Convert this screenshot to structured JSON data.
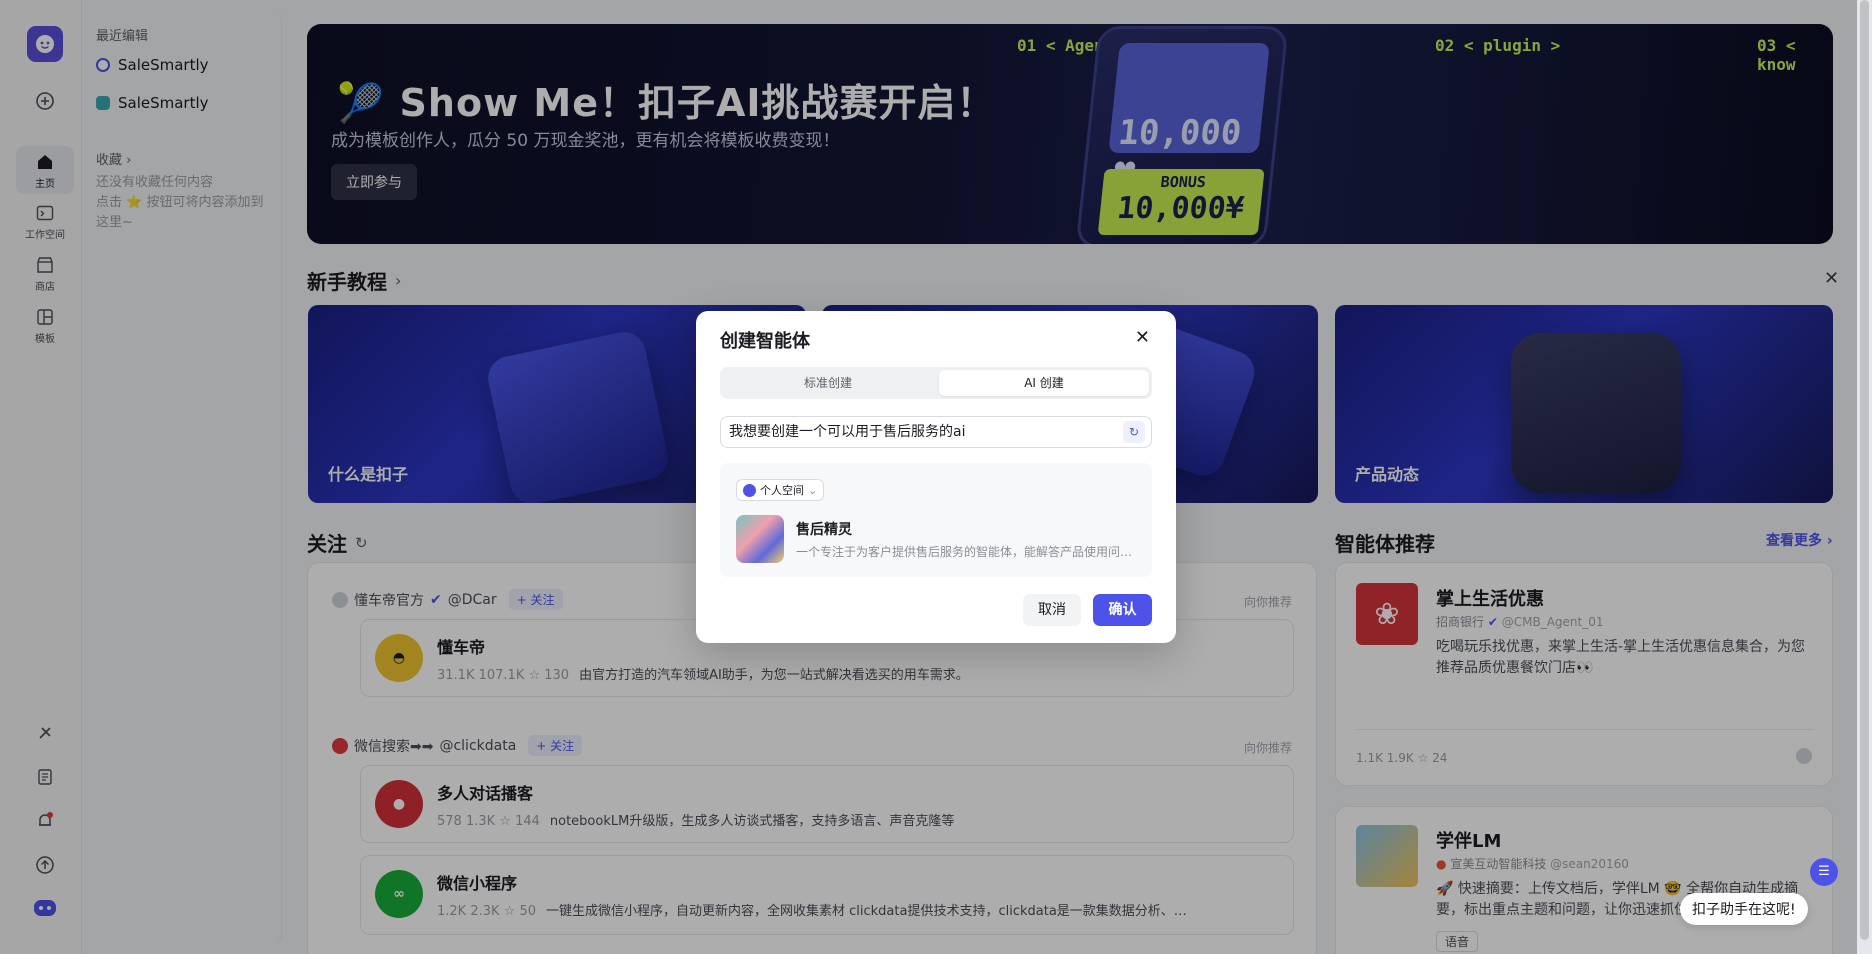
{
  "rail": {
    "items": [
      {
        "label": "主页",
        "icon": "home-icon"
      },
      {
        "label": "工作空间",
        "icon": "terminal-icon"
      },
      {
        "label": "商店",
        "icon": "store-icon"
      },
      {
        "label": "模板",
        "icon": "template-icon"
      }
    ]
  },
  "side": {
    "recent_title": "最近编辑",
    "recent": [
      {
        "label": "SaleSmartly"
      },
      {
        "label": "SaleSmartly"
      }
    ],
    "fav_title": "收藏",
    "fav_empty": "还没有收藏任何内容\n点击 ⭐ 按钮可将内容添加到这里~"
  },
  "banner": {
    "title": "🎾 Show Me！扣子AI挑战赛开启！",
    "subtitle": "成为模板创作人，瓜分 50 万现金奖池，更有机会将模板收费变现！",
    "join": "立即参与",
    "tags": [
      "01 < Agent>",
      "02 < plugin >",
      "03 < know"
    ],
    "score": "10,000 ♥",
    "bonus_label": "BONUS",
    "bonus_value": "10,000¥"
  },
  "tutorials": {
    "title": "新手教程",
    "cards": [
      "什么是扣子",
      "",
      "产品动态"
    ]
  },
  "follow": {
    "title": "关注",
    "groups": [
      {
        "author": "懂车帝官方",
        "handle": "@DCar",
        "follow_label": "+ 关注",
        "rec": "向你推荐",
        "items": [
          {
            "name": "懂车帝",
            "meta": "31.1K   107.1K   ☆ 130",
            "desc": "由官方打造的汽车领域AI助手，为您一站式解决看选买的用车需求。"
          }
        ]
      },
      {
        "author": "微信搜索➡➡",
        "handle": "@clickdata",
        "follow_label": "+ 关注",
        "rec": "向你推荐",
        "items": [
          {
            "name": "多人对话播客",
            "meta": "578   1.3K   ☆ 144",
            "desc": "notebookLM升级版，生成多人访谈式播客，支持多语言、声音克隆等"
          },
          {
            "name": "微信小程序",
            "meta": "1.2K   2.3K   ☆ 50",
            "desc": "一键生成微信小程序，自动更新内容，全网收集素材 clickdata提供技术支持，clickdata是一款集数据分析、…"
          }
        ]
      }
    ]
  },
  "agents": {
    "title": "智能体推荐",
    "more": "查看更多 ›",
    "cards": [
      {
        "name": "掌上生活优惠",
        "org": "招商银行",
        "handle": "@CMB_Agent_01",
        "desc": "吃喝玩乐找优惠，来掌上生活-掌上生活优惠信息集合，为您推荐品质优惠餐饮门店👀",
        "stats": "1.1K   1.9K   ☆ 24"
      },
      {
        "name": "学伴LM",
        "org": "宣美互动智能科技",
        "handle": "@sean20160",
        "desc": "🚀 快速摘要：上传文档后，学伴LM 🤓 全帮你自动生成摘要，标出重点主题和问题，让你迅速抓住",
        "tag": "语音"
      }
    ]
  },
  "dialog": {
    "title": "创建智能体",
    "tab_standard": "标准创建",
    "tab_ai": "AI 创建",
    "prompt": "我想要创建一个可以用于售后服务的ai",
    "space": "个人空间",
    "result_name": "售后精灵",
    "result_desc": "一个专注于为客户提供售后服务的智能体，能解答产品使用问题…",
    "cancel": "取消",
    "confirm": "确认"
  },
  "helper": {
    "text": "扣子助手在这呢!"
  },
  "colors": {
    "accent": "#4d53e8",
    "banner_green": "#c9ef53"
  }
}
